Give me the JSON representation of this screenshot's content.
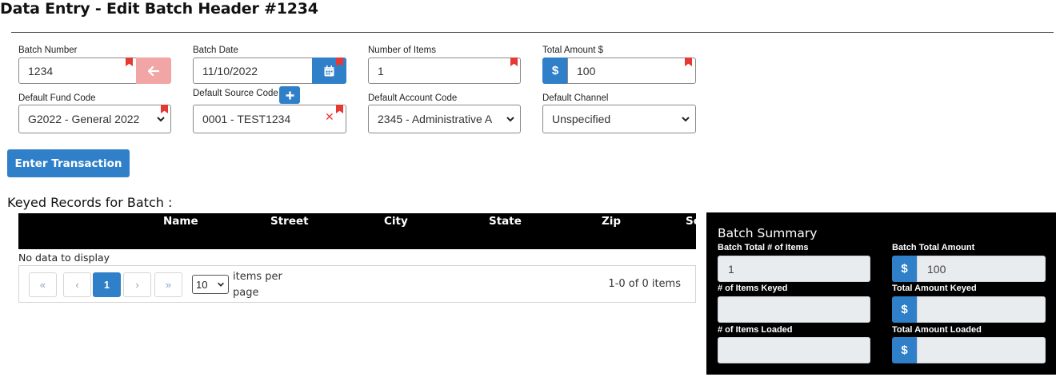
{
  "page": {
    "title": "Data Entry - Edit Batch Header #1234"
  },
  "form": {
    "batch_number": {
      "label": "Batch Number",
      "value": "1234"
    },
    "batch_date": {
      "label": "Batch Date",
      "value": "11/10/2022"
    },
    "number_of_items": {
      "label": "Number of Items",
      "value": "1"
    },
    "total_amount": {
      "label": "Total Amount $",
      "currency_symbol": "$",
      "value": "100"
    },
    "default_fund_code": {
      "label": "Default Fund Code",
      "selected": "G2022 - General 2022"
    },
    "default_source_code": {
      "label": "Default Source Code",
      "value": "0001 - TEST1234",
      "clear_symbol": "✕"
    },
    "default_account_code": {
      "label": "Default Account Code",
      "selected": "2345 - Administrative A"
    },
    "default_channel": {
      "label": "Default Channel",
      "selected": "Unspecified"
    }
  },
  "actions": {
    "enter_transaction": "Enter Transaction"
  },
  "grid": {
    "section_title": "Keyed Records for Batch :",
    "columns": [
      "Name",
      "Street",
      "City",
      "State",
      "Zip",
      "Sc"
    ],
    "empty_text": "No data to display",
    "pager": {
      "first": "«",
      "prev": "‹",
      "current_page": "1",
      "next": "›",
      "last": "»",
      "page_size": "10",
      "items_per_page": "items per page",
      "range": "1-0 of 0 items"
    }
  },
  "summary": {
    "title": "Batch Summary",
    "currency_symbol": "$",
    "total_items": {
      "label": "Batch Total # of Items",
      "value": "1"
    },
    "total_amount": {
      "label": "Batch Total Amount",
      "value": "100"
    },
    "items_keyed": {
      "label": "# of Items Keyed",
      "value": ""
    },
    "amount_keyed": {
      "label": "Total Amount Keyed",
      "value": ""
    },
    "items_loaded": {
      "label": "# of Items Loaded",
      "value": ""
    },
    "amount_loaded": {
      "label": "Total Amount Loaded",
      "value": ""
    }
  },
  "colors": {
    "primary": "#2f80c8",
    "required_marker": "#e53935",
    "back_button": "#f2a5a5",
    "grid_header": "#000000",
    "summary_panel": "#000000"
  }
}
